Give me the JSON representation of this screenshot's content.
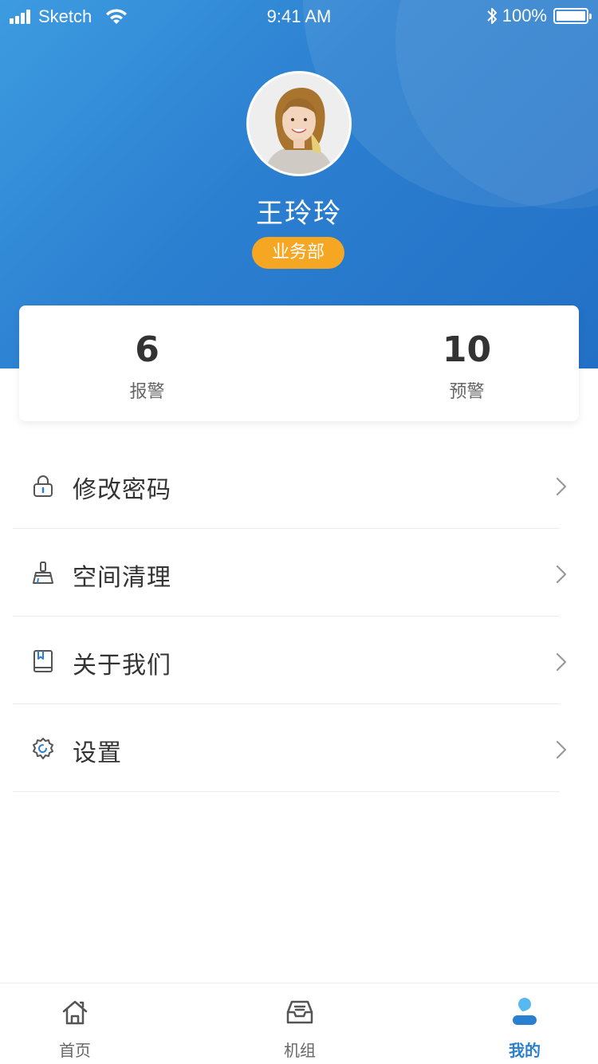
{
  "status_bar": {
    "carrier": "Sketch",
    "time": "9:41 AM",
    "battery": "100%"
  },
  "profile": {
    "name": "王玲玲",
    "department": "业务部"
  },
  "stats": {
    "alarm": {
      "value": "6",
      "label": "报警"
    },
    "warning": {
      "value": "10",
      "label": "预警"
    }
  },
  "menu": {
    "items": [
      {
        "label": "修改密码",
        "icon": "lock-icon"
      },
      {
        "label": "空间清理",
        "icon": "broom-icon"
      },
      {
        "label": "关于我们",
        "icon": "book-icon"
      },
      {
        "label": "设置",
        "icon": "gear-icon"
      }
    ]
  },
  "tabs": {
    "items": [
      {
        "label": "首页",
        "icon": "home-icon"
      },
      {
        "label": "机组",
        "icon": "inbox-icon"
      },
      {
        "label": "我的",
        "icon": "user-icon"
      }
    ],
    "active": "我的"
  },
  "colors": {
    "header_blue": "#2b7fd0",
    "badge_orange": "#f5a623",
    "active_tab": "#2b7fd0"
  }
}
